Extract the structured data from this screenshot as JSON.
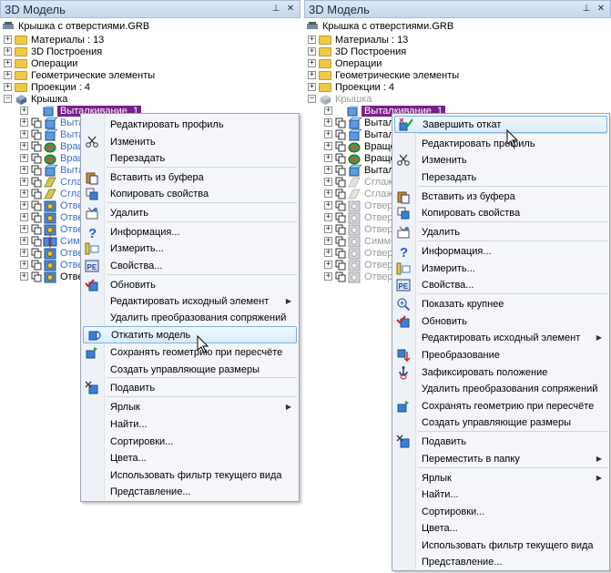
{
  "panel_title": "3D Модель",
  "pin_glyph": "📌",
  "close_glyph": "✕",
  "tree": {
    "root": "Крышка с отверстиями.GRB",
    "materials": "Материалы : 13",
    "build3d": "3D Построения",
    "operations": "Операции",
    "geom": "Геометрические элементы",
    "projections": "Проекции : 4",
    "part": "Крышка",
    "selected": "Выталкивание_1",
    "left_children": [
      "Выта",
      "Выта",
      "Вращ",
      "Вращ",
      "Выта",
      "Сгла",
      "Сгла",
      "Отве",
      "Отве",
      "Отве",
      "Симм",
      "Отве",
      "Отве",
      "Отве"
    ],
    "right_children": [
      "Выталк",
      "Выталк",
      "Вращен",
      "Вращен",
      "Выталк",
      "Сглажи",
      "Сглажи",
      "Отверс",
      "Отверс",
      "Отверс",
      "Симмет",
      "Отверс",
      "Отверс",
      "Отверс"
    ]
  },
  "left_menu": [
    "Редактировать профиль",
    "Изменить",
    "Перезадать",
    "Вставить из буфера",
    "Копировать свойства",
    "Удалить",
    "Информация...",
    "Измерить...",
    "Свойства...",
    "Обновить",
    "Редактировать исходный элемент",
    "Удалить преобразования сопряжений",
    "Откатить модель",
    "Сохранять геометрию при пересчёте",
    "Создать управляющие размеры",
    "Подавить",
    "Ярлык",
    "Найти...",
    "Сортировки...",
    "Цвета...",
    "Использовать фильтр текущего вида",
    "Представление..."
  ],
  "right_menu": [
    "Завершить откат",
    "Редактировать профиль",
    "Изменить",
    "Перезадать",
    "Вставить из буфера",
    "Копировать свойства",
    "Удалить",
    "Информация...",
    "Измерить...",
    "Свойства...",
    "Показать крупнее",
    "Обновить",
    "Редактировать исходный элемент",
    "Преобразование",
    "Зафиксировать положение",
    "Удалить преобразования сопряжений",
    "Сохранять геометрию при пересчёте",
    "Создать управляющие размеры",
    "Подавить",
    "Переместить в папку",
    "Ярлык",
    "Найти...",
    "Сортировки...",
    "Цвета...",
    "Использовать фильтр текущего вида",
    "Представление..."
  ],
  "submenu_arrow": "▶",
  "colors": {
    "selected_bg": "#7a1f8a",
    "child_blue": "#3b6fd0",
    "child_gray": "#9a9a9a",
    "highlight_border": "#7fb2e0"
  }
}
